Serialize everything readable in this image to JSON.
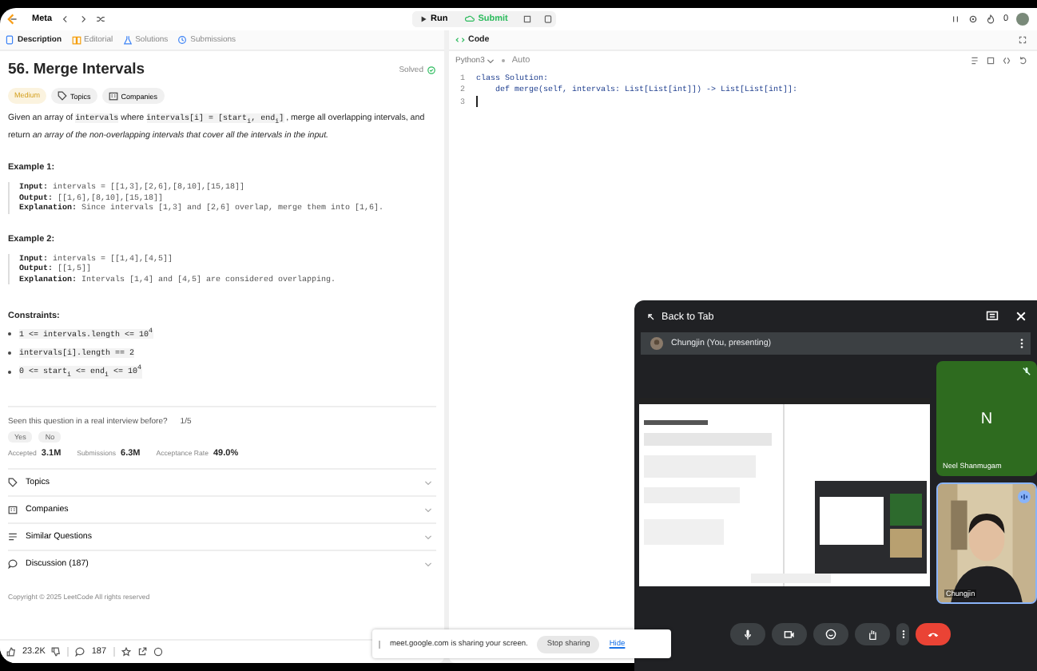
{
  "top_bar": {
    "problem_list": "Meta",
    "run": "Run",
    "submit": "Submit",
    "likes_count": "0"
  },
  "left_tabs": [
    {
      "label": "Description",
      "selected": true,
      "kind": "doc"
    },
    {
      "label": "Editorial",
      "selected": false,
      "kind": "book"
    },
    {
      "label": "Solutions",
      "selected": false,
      "kind": "flask"
    },
    {
      "label": "Submissions",
      "selected": false,
      "kind": "history"
    }
  ],
  "problem": {
    "title": "56. Merge Intervals",
    "status": "Solved",
    "difficulty": "Medium",
    "tags": [
      {
        "label": "Topics",
        "kind": "tag"
      },
      {
        "label": "Companies",
        "kind": "building"
      }
    ],
    "description": [
      {
        "kind": "text",
        "text": "Given an array of"
      },
      {
        "kind": "code",
        "text": "intervals"
      },
      {
        "kind": "text",
        "text": "where"
      },
      {
        "kind": "code",
        "text": "intervals[i] = [start$_{i}$, end$_{i}$]"
      },
      {
        "kind": "text",
        "text": ", merge all overlapping intervals, and return"
      },
      {
        "kind": "italic",
        "text": "an array of the non-overlapping intervals that cover all the intervals in the input."
      }
    ],
    "examples": [
      {
        "title": "Example 1:",
        "lines": [
          {
            "label": "Input:",
            "value": "intervals = [[1,3],[2,6],[8,10],[15,18]]"
          },
          {
            "label": "Output:",
            "value": "[[1,6],[8,10],[15,18]]"
          },
          {
            "label": "Explanation:",
            "value": "Since intervals [1,3] and [2,6] overlap, merge them into [1,6]."
          }
        ]
      },
      {
        "title": "Example 2:",
        "lines": [
          {
            "label": "Input:",
            "value": "intervals = [[1,4],[4,5]]"
          },
          {
            "label": "Output:",
            "value": "[[1,5]]"
          },
          {
            "label": "Explanation:",
            "value": "Intervals [1,4] and [4,5] are considered overlapping."
          }
        ]
      }
    ],
    "constraints_title": "Constraints:",
    "constraints": [
      "1 <= intervals.length <= 10$^{4}$",
      "intervals[i].length == 2",
      "0 <= start$_{i}$ <= end$_{i}$ <= 10$^{4}$"
    ],
    "interview": {
      "question": "Seen this question in a real interview before?",
      "count": "1/5",
      "answers": [
        "Yes",
        "No"
      ]
    },
    "stats": [
      {
        "label": "Accepted",
        "value": "3.1M"
      },
      {
        "label": "Submissions",
        "value": "6.3M"
      },
      {
        "label": "Acceptance Rate",
        "value": "49.0%"
      }
    ],
    "sections": [
      {
        "label": "Topics",
        "kind": "tag"
      },
      {
        "label": "Companies",
        "kind": "building"
      },
      {
        "label": "Similar Questions",
        "kind": "list"
      },
      {
        "label": "Discussion (187)",
        "kind": "chat"
      }
    ],
    "copyright": "Copyright © 2025 LeetCode All rights reserved",
    "bottom_bar": {
      "likes": "23.2K",
      "comments": "187"
    }
  },
  "code": {
    "title": "Code",
    "language": "Python3",
    "mode": "Auto",
    "lines": [
      {
        "number": "1",
        "text": "class Solution:",
        "cursor": false
      },
      {
        "number": "2",
        "text": "    def merge(self, intervals: List[List[int]]) -> List[List[int]]:",
        "cursor": false
      },
      {
        "number": "3",
        "cursor": true
      }
    ]
  },
  "meeting": {
    "back": "Back to Tab",
    "presenter": "Chungjin (You, presenting)",
    "participants": [
      {
        "name": "Neel Shanmugam",
        "initial": "N",
        "kind": "avatar",
        "muted": true
      },
      {
        "name": "Chungjin",
        "kind": "camera",
        "muted": false
      }
    ]
  },
  "share_banner": {
    "message": "meet.google.com is sharing your screen.",
    "stop": "Stop sharing",
    "hide": "Hide"
  }
}
